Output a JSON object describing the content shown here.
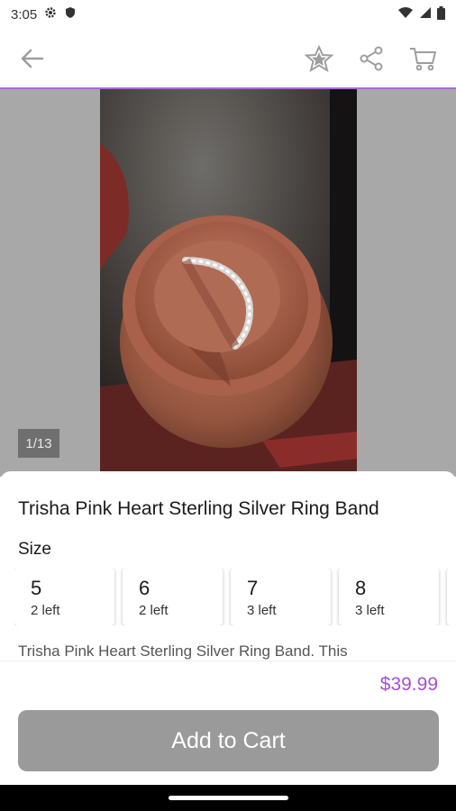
{
  "status_bar": {
    "time": "3:05",
    "icons": [
      "gear-icon",
      "shield-icon",
      "wifi-icon",
      "signal-icon",
      "battery-icon"
    ]
  },
  "app_bar": {
    "icons": [
      "back-arrow-icon",
      "star-icon",
      "share-icon",
      "cart-icon"
    ]
  },
  "gallery": {
    "counter": "1/13"
  },
  "product": {
    "title": "Trisha Pink Heart Sterling Silver Ring Band",
    "size_label": "Size",
    "sizes": [
      {
        "size": "5",
        "stock": "2 left"
      },
      {
        "size": "6",
        "stock": "2 left"
      },
      {
        "size": "7",
        "stock": "3 left"
      },
      {
        "size": "8",
        "stock": "3 left"
      }
    ],
    "description": "Trisha Pink Heart Sterling Silver Ring Band. This"
  },
  "footer": {
    "price": "$39.99",
    "add_to_cart": "Add to Cart"
  },
  "colors": {
    "accent": "#a64fd6",
    "button": "#9a9a9a",
    "gallery_bg": "#a8a8a8"
  }
}
